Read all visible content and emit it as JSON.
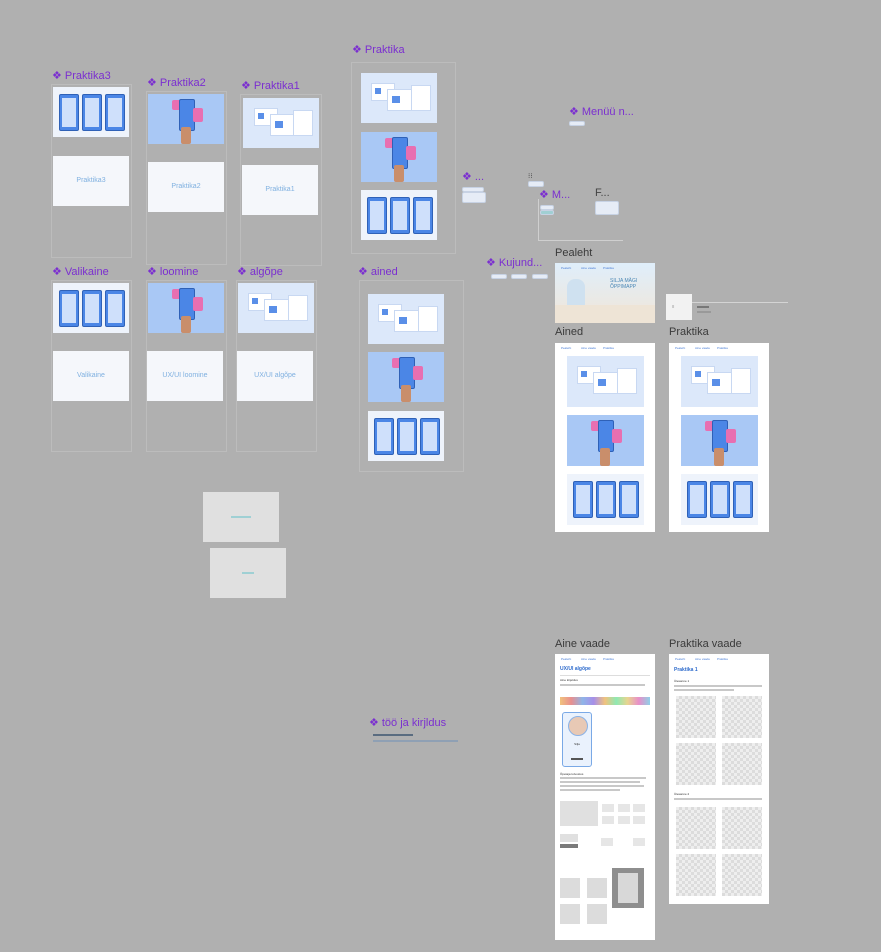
{
  "components": {
    "praktika3": "Praktika3",
    "praktika2": "Praktika2",
    "praktika1": "Praktika1",
    "praktika": "Praktika",
    "menu": "Menüü n...",
    "dot_comp": "...",
    "m_comp": "M...",
    "f_comp": "F...",
    "kujund": "Kujund...",
    "valikaine": "Valikaine",
    "loomine": "loomine",
    "algope": "algõpe",
    "ained": "ained",
    "too": "töö ja kirjldus"
  },
  "thumb_texts": {
    "praktika3": "Praktika3",
    "praktika2": "Praktika2",
    "praktika1": "Praktika1",
    "valikaine": "Valikaine",
    "uxui_loomine": "UX/UI loomine",
    "uxui_algope": "UX/UI algõpe"
  },
  "frames": {
    "pealeht": "Pealeht",
    "ained": "Ained",
    "praktika": "Praktika",
    "aine_vaade": "Aine vaade",
    "praktika_vaade": "Praktika vaade"
  },
  "hero_text": "SILJA MÄGI\nÕPPIMAPP",
  "nav_items": [
    "Pealeht",
    "Aine vaade",
    "Praktika"
  ],
  "aine_vaade": {
    "title": "UX/UI algõpe",
    "section1": "Aine kirjeldus",
    "section2": "Õpetaja tutvustus",
    "teacher_name": "Silja"
  },
  "praktika_vaade": {
    "title": "Praktika 1",
    "section1": "Ülesanne 1",
    "section2": "Ülesanne 2"
  },
  "colors": {
    "canvas": "#b0b0b0",
    "component_label": "#7b2fd0",
    "frame_label": "#3a3a3a",
    "brand_blue": "#4b86e6"
  }
}
